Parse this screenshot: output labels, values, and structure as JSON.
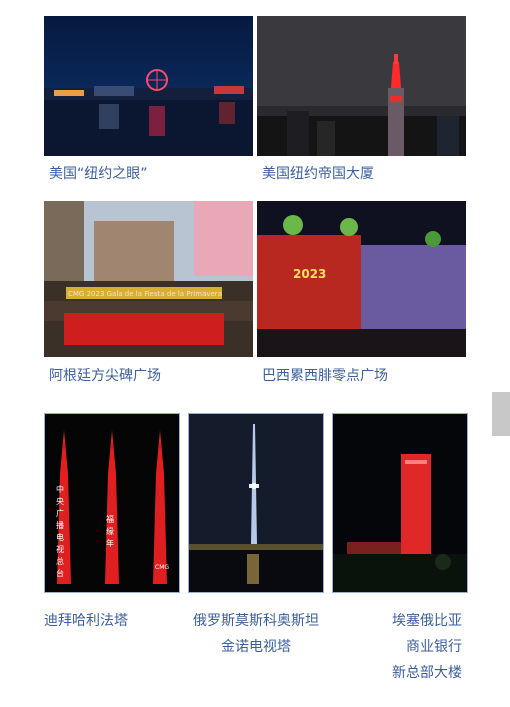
{
  "photos": [
    {
      "caption": "美国“纽约之眼”"
    },
    {
      "caption": "美国纽约帝国大厦"
    },
    {
      "caption": "阿根廷方尖碑广场",
      "banner_text": "CMG 2023 Gala de la Fiesta de la Primavera"
    },
    {
      "caption": "巴西累西腓零点广场",
      "projection_text": "2023"
    },
    {
      "caption": "迪拜哈利法塔",
      "tower_texts": [
        "中央广播电视总台",
        "福缘年",
        "CMG"
      ]
    },
    {
      "caption_lines": [
        "俄罗斯莫斯科奥斯坦",
        "金诺电视塔"
      ]
    },
    {
      "caption_lines": [
        "埃塞俄比亚",
        "商业银行",
        "新总部大楼"
      ]
    }
  ],
  "colors": {
    "caption": "#3c5f9e",
    "festive_red": "#e02020"
  }
}
